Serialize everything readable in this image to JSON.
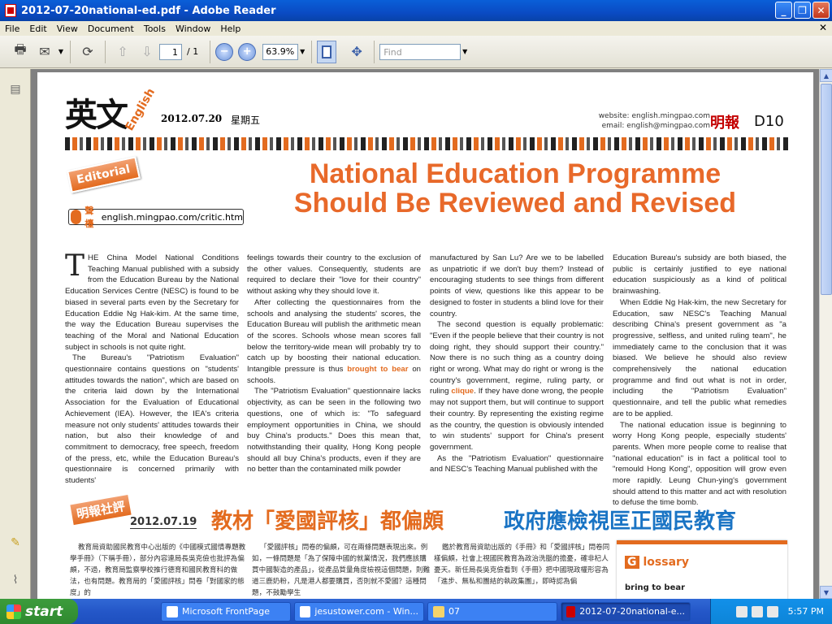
{
  "window": {
    "title": "2012-07-20national-ed.pdf - Adobe Reader"
  },
  "menu": [
    "File",
    "Edit",
    "View",
    "Document",
    "Tools",
    "Window",
    "Help"
  ],
  "toolbar": {
    "page_current": "1",
    "page_total": "/ 1",
    "zoom": "63.9%",
    "find_placeholder": "Find"
  },
  "paper": {
    "masthead": "英文",
    "masthead_en": "English",
    "date": "2012.07.20",
    "weekday": "星期五",
    "website": "website: english.mingpao.com",
    "email": "email: english@mingpao.com",
    "brand": "明報",
    "page": "D10",
    "tag": "Editorial",
    "link_label": "聲檯",
    "link_url": "english.mingpao.com/critic.htm",
    "headline_1": "National Education Programme",
    "headline_2": "Should Be Reviewed and Revised",
    "col1_p1_dropcap": "T",
    "col1_p1": "HE China Model National Conditions Teaching Manual published with a subsidy from the Education Bureau by the National Education Services Centre (NESC) is found to be biased in several parts even by the Secretary for Education Eddie Ng Hak-kim. At the same time, the way the Education Bureau supervises the teaching of the Moral and National Education subject in schools is not quite right.",
    "col1_p2": "The Bureau's \"Patriotism Evaluation\" questionnaire contains questions on \"students' attitudes towards the nation\", which are based on the criteria laid down by the International Association for the Evaluation of Educational Achievement (IEA). However, the IEA's criteria measure not only students' attitudes towards their nation, but also their knowledge of and commitment to democracy, free speech, freedom of the press, etc, while the Education Bureau's questionnaire is concerned primarily with students'",
    "col2_p1": "feelings towards their country to the exclusion of the other values. Consequently, students are required to declare their \"love for their country\" without asking why they should love it.",
    "col2_p2a": "After collecting the questionnaires from the schools and analysing the students' scores, the Education Bureau will publish the arithmetic mean of the scores. Schools whose mean scores fall below the territory-wide mean will probably try to catch up by boosting their national education. Intangible pressure is thus ",
    "col2_p2_hl": "brought to bear",
    "col2_p2b": " on schools.",
    "col2_p3": "The \"Patriotism Evaluation\" questionnaire lacks objectivity, as can be seen in the following two questions, one of which is: \"To safeguard employment opportunities in China, we should buy China's products.\" Does this mean that, notwithstanding their quality, Hong Kong people should all buy China's products, even if they are no better than the contaminated milk powder",
    "col3_p1": "manufactured by San Lu? Are we to be labelled as unpatriotic if we don't buy them? Instead of encouraging students to see things from different points of view, questions like this appear to be designed to foster in students a blind love for their country.",
    "col3_p2a": "The second question is equally problematic: \"Even if the people believe that their country is not doing right, they should support their country.\" Now there is no such thing as a country doing right or wrong. What may do right or wrong is the country's government, regime, ruling party, or ruling ",
    "col3_p2_hl": "clique",
    "col3_p2b": ". If they have done wrong, the people may not support them, but will continue to support their country. By representing the existing regime as the country, the question is obviously intended to win students' support for China's present government.",
    "col3_p3": "As the \"Patriotism Evaluation\" questionnaire and NESC's Teaching Manual published with the",
    "col4_p1": "Education Bureau's subsidy are both biased, the public is certainly justified to eye national education suspiciously as a kind of political brainwashing.",
    "col4_p2": "When Eddie Ng Hak-kim, the new Secretary for Education, saw NESC's Teaching Manual describing China's present government as \"a progressive, selfless, and united ruling team\", he immediately came to the conclusion that it was biased. We believe he should also review comprehensively the national education programme and find out what is not in order, including the \"Patriotism Evaluation\" questionnaire, and tell the public what remedies are to be applied.",
    "col4_p3": "The national education issue is beginning to worry Hong Kong people, especially students' parents. When more people come to realise that \"national education\" is in fact a political tool to \"remould Hong Kong\", opposition will grow even more rapidly. Leung Chun-ying's government should attend to this matter and act with resolution to defuse the time bomb.",
    "cn_tag": "明報社評",
    "cn_date": "2012.07.19",
    "cn_head_1": "教材「愛國評核」都偏頗",
    "cn_head_2": "政府應檢視匡正國民教育",
    "cn_col1": "教育局資助國民教育中心出版的《中國模式國情專題教學手冊》（下稱手冊），部分內容連局長吳克儉也批評為偏頗，不過，教育局監察學校推行德育和國民教育科的做法，也有問題。教育局的「愛國評核」問卷「對國家的態度」的",
    "cn_col2": "「愛國評核」問卷的偏頗，可在兩條問題表現出來。例如，一條問題是「為了保障中國的就業情況，我們應該購買中國製造的產品」，從產品質量角度檢視這個問題，則難道三鹿奶粉，凡是港人都要購買，否則就不愛國？這種問題，不鼓勵學生",
    "cn_col3": "鑑於教育局資助出版的《手冊》和「愛國評核」問卷同樣偏頗，社會上視國民教育為政治洗腦的擔憂，確非杞人憂天。新任局長吳克儉看到《手冊》把中國現政權形容為「進步、無私和團結的執政集團」，即時認為偏",
    "glossary_title": "lossary",
    "glossary_first": "G",
    "glossary_item": "bring to bear"
  },
  "taskbar": {
    "start": "start",
    "tasks": [
      "Microsoft FrontPage",
      "jesustower.com - Win...",
      "07",
      "2012-07-20national-e..."
    ],
    "clock": "5:57 PM"
  }
}
